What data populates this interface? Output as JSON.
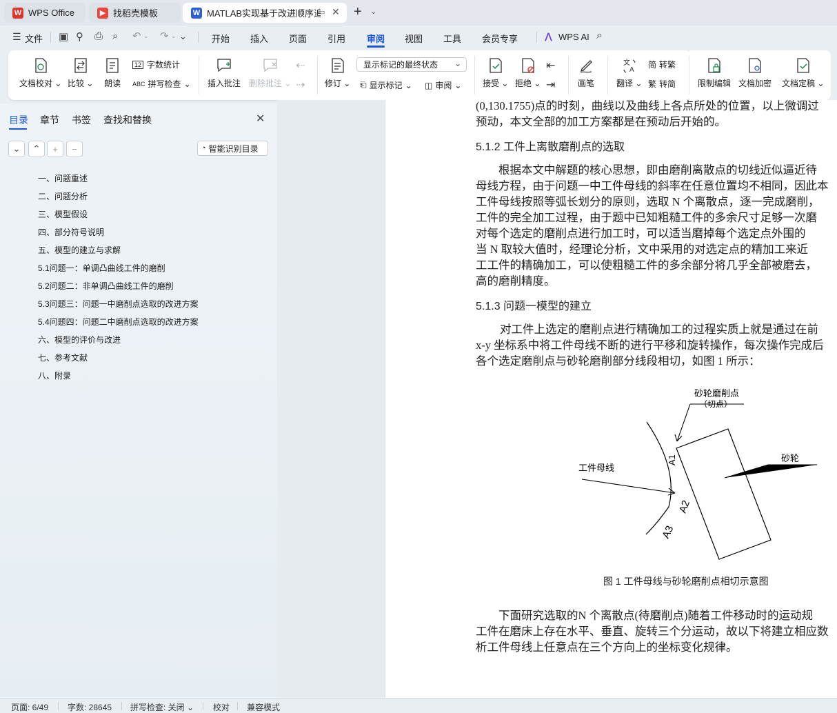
{
  "tabs": [
    {
      "label": "WPS Office"
    },
    {
      "label": "找稻壳模板"
    },
    {
      "label": "MATLAB实现基于改进顺序追踪"
    }
  ],
  "menu": {
    "file": "文件",
    "items": [
      "开始",
      "插入",
      "页面",
      "引用",
      "审阅",
      "视图",
      "工具",
      "会员专享"
    ],
    "active": "审阅",
    "wps_ai": "WPS AI"
  },
  "ribbon": {
    "doc_proof": "文档校对",
    "compare": "比较",
    "read_aloud": "朗读",
    "word_count": "字数统计",
    "spell_check": "拼写检查",
    "insert_comment": "插入批注",
    "delete_comment": "删除批注",
    "revise": "修订",
    "markup_state": "显示标记的最终状态",
    "show_markup": "显示标记",
    "review": "审阅",
    "accept": "接受",
    "reject": "拒绝",
    "pen": "画笔",
    "translate": "翻译",
    "to_traditional": "转繁",
    "to_simplified": "转简",
    "restrict_edit": "限制编辑",
    "encrypt": "文档加密",
    "finalize": "文档定稿"
  },
  "nav": {
    "tabs": [
      "目录",
      "章节",
      "书签",
      "查找和替换"
    ],
    "smart_toc": "智能识别目录",
    "toc": [
      "一、问题重述",
      "二、问题分析",
      "三、模型假设",
      "四、部分符号说明",
      "五、模型的建立与求解",
      "5.1问题一：单调凸曲线工件的磨削",
      "5.2问题二：非单调凸曲线工件的磨削",
      "5.3问题三：问题一中磨削点选取的改进方案",
      "5.4问题四：问题二中磨削点选取的改进方案",
      "六、模型的评价与改进",
      "七、参考文献",
      "八、附录"
    ]
  },
  "doc": {
    "top_line1": "(0,130.1755)点的时刻，曲线以及曲线上各点所处的位置，以上微调过",
    "top_line2": "预动，本文全部的加工方案都是在预动后开始的。",
    "h512": "5.1.2  工件上离散磨削点的选取",
    "p512": [
      "根据本文中解题的核心思想，即由磨削离散点的切线近似逼近待",
      "母线方程，由于问题一中工件母线的斜率在任意位置均不相同，因此本",
      "工件母线按照等弧长划分的原则，选取 N 个离散点，逐一完成磨削，",
      "工件的完全加工过程，由于题中已知粗糙工件的多余尺寸足够一次磨",
      "对每个选定的磨削点进行加工时，可以适当磨掉每个选定点外围的",
      "当 N 取较大值时，经理论分析，文中采用的对选定点的精加工来近",
      "工工件的精确加工，可以使粗糙工件的多余部分将几乎全部被磨去，",
      "高的磨削精度。"
    ],
    "h513": "5.1.3  问题一模型的建立",
    "p513": [
      "对工件上选定的磨削点进行精确加工的过程实质上就是通过在前",
      "x-y 坐标系中将工件母线不断的进行平移和旋转操作，每次操作完成后",
      "各个选定磨削点与砂轮磨削部分线段相切，如图 1 所示："
    ],
    "fig": {
      "label_point": "砂轮磨削点",
      "label_point_sub": "（切点）",
      "label_wheel": "砂轮",
      "label_workpiece": "工件母线",
      "a1": "A1",
      "a2": "A2",
      "a3": "A3",
      "caption": "图 1   工件母线与砂轮磨削点相切示意图"
    },
    "p_next": [
      "下面研究选取的N 个离散点(待磨削点)随着工件移动时的运动规",
      "工件在磨床上存在水平、垂直、旋转三个分运动，故以下将建立相应数",
      "析工件母线上任意点在三个方向上的坐标变化规律。"
    ]
  },
  "status": {
    "page": "页面: 6/49",
    "words": "字数: 28645",
    "spell": "拼写检查: 关闭",
    "proof": "校对",
    "compat": "兼容模式"
  },
  "colors": {
    "accent": "#1a56db",
    "wps_red": "#e0312a"
  }
}
